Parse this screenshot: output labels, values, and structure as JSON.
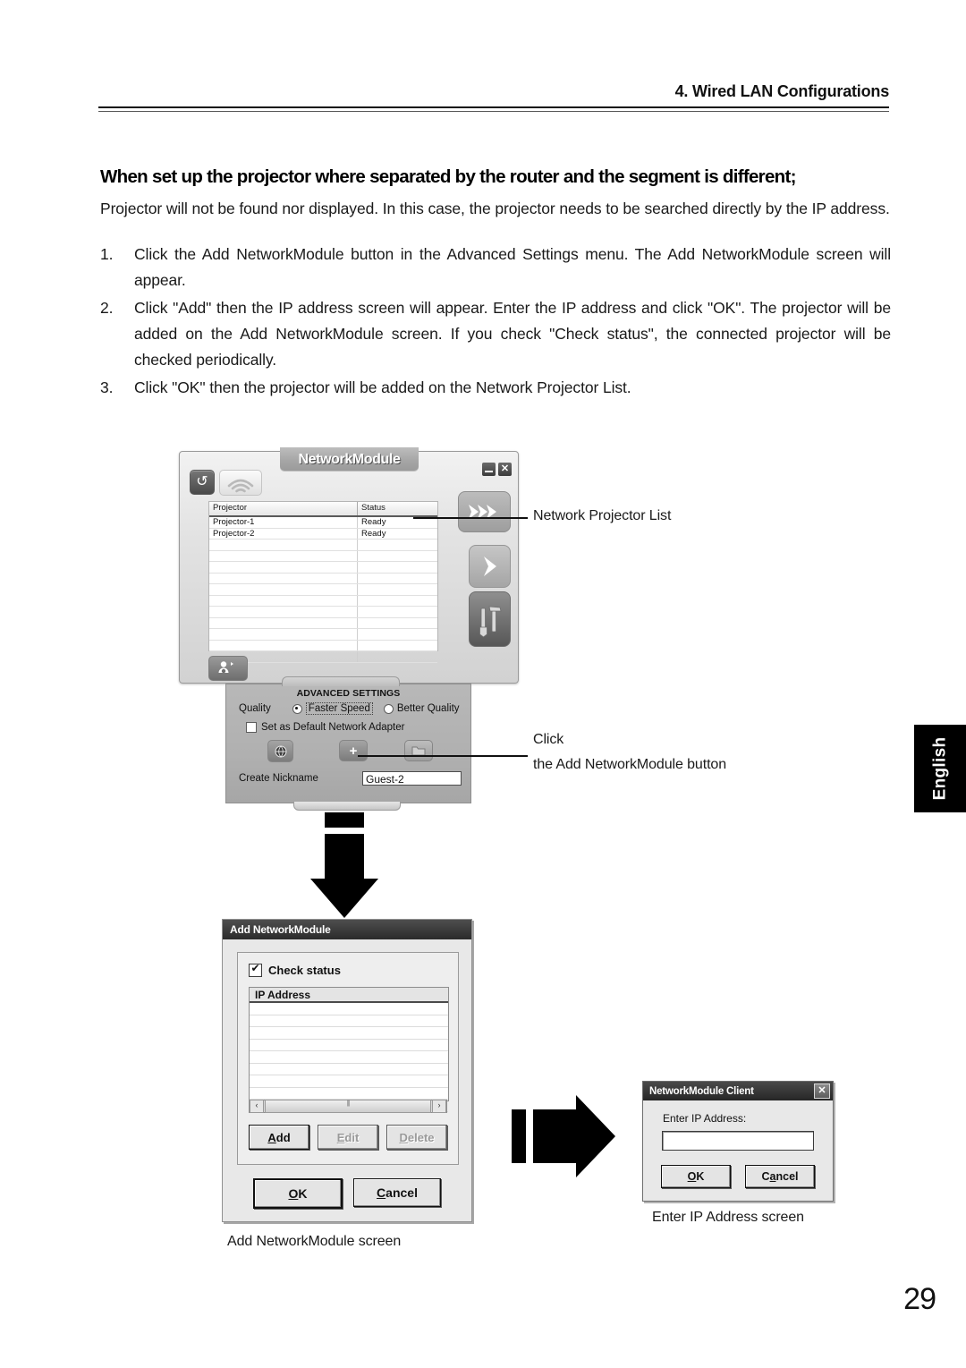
{
  "header": {
    "chapter": "4. Wired LAN Configurations"
  },
  "body": {
    "heading": "When set up the projector where separated by the router and the segment is different;",
    "lead": "Projector will not be found nor displayed.  In this case, the projector needs to be searched directly by the IP address.",
    "steps": [
      {
        "num": "1.",
        "text": "Click the Add NetworkModule button in the Advanced Settings menu.  The Add NetworkModule screen will appear."
      },
      {
        "num": "2.",
        "text": "Click \"Add\" then the IP address screen will appear.  Enter the IP address and click \"OK\".  The projector will be added on the Add NetworkModule screen.  If you check \"Check status\", the connected projector will be checked periodically."
      },
      {
        "num": "3.",
        "text": "Click \"OK\" then the projector will be added on the Network Projector List."
      }
    ]
  },
  "side_tab": {
    "label": "English"
  },
  "page_number": "29",
  "network_module_window": {
    "title": "NetworkModule",
    "window_buttons": {
      "minimize": "minimize-icon",
      "close": "✕"
    },
    "toolbar": {
      "refresh_icon": "↺",
      "wifi_icon": "wifi-icon"
    },
    "table": {
      "columns": [
        "Projector",
        "Status"
      ],
      "rows": [
        {
          "projector": "Projector-1",
          "status": "Ready"
        },
        {
          "projector": "Projector-2",
          "status": "Ready"
        }
      ],
      "empty_row_count": 12
    },
    "side_buttons": {
      "fast_forward": "»›",
      "next": "›",
      "tools": "tools-icon"
    },
    "bottom_button": "user-presenter-icon"
  },
  "advanced_settings": {
    "title": "ADVANCED SETTINGS",
    "quality_label": "Quality",
    "quality_options": [
      {
        "label": "Faster Speed",
        "selected": true
      },
      {
        "label": "Better Quality",
        "selected": false
      }
    ],
    "default_adapter_label": "Set as Default Network Adapter",
    "default_adapter_checked": false,
    "icon_buttons": {
      "globe": "globe-icon",
      "add": "+",
      "folder": "folder-icon"
    },
    "nickname_label": "Create Nickname",
    "nickname_value": "Guest-2"
  },
  "add_networkmodule_dialog": {
    "title": "Add NetworkModule",
    "check_status_label": "Check status",
    "check_status_checked": true,
    "list_header": "IP Address",
    "list_rows": [],
    "empty_row_count": 9,
    "scrollbar": {
      "left_arrow": "‹",
      "right_arrow": "›"
    },
    "buttons": [
      {
        "label": "Add",
        "accel": "A",
        "disabled": false
      },
      {
        "label": "Edit",
        "accel": "E",
        "disabled": true
      },
      {
        "label": "Delete",
        "accel": "D",
        "disabled": true
      }
    ],
    "ok_label": "OK",
    "cancel_label": "Cancel",
    "caption": "Add NetworkModule screen"
  },
  "client_dialog": {
    "title": "NetworkModule Client",
    "close_icon": "✕",
    "prompt": "Enter IP Address:",
    "input_value": "",
    "ok_label": "OK",
    "cancel_label": "Cancel",
    "caption": "Enter IP Address screen"
  },
  "callouts": {
    "projector_list": "Network Projector List",
    "click_line1": "Click",
    "click_line2": "the Add NetworkModule button"
  },
  "colors": {
    "page_bg": "#ffffff",
    "text": "#1a1a1a",
    "tab_bg": "#000000",
    "dialog_face": "#e8e8e8",
    "titlebar_dark": "#2b2b2b"
  }
}
